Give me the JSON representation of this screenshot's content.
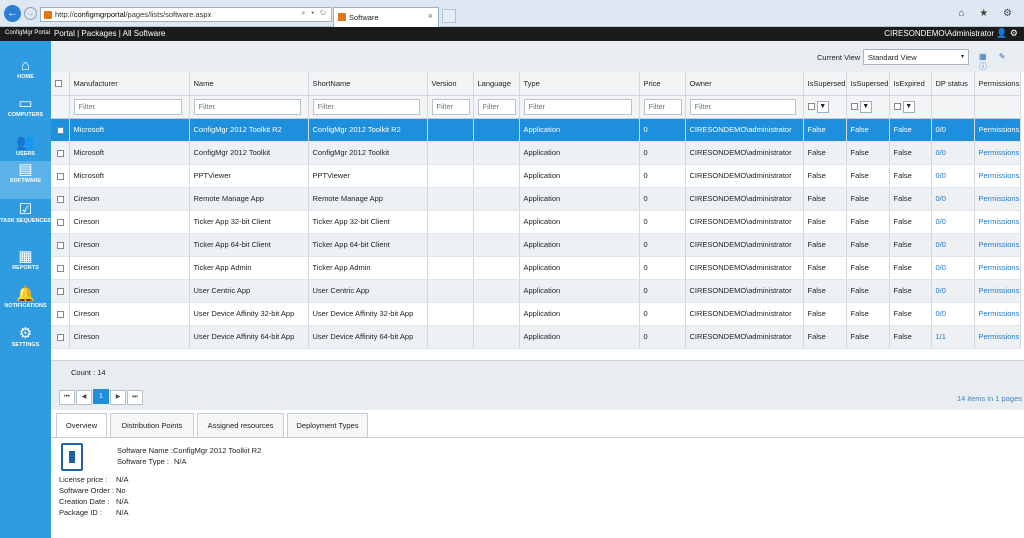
{
  "browser": {
    "url_prefix": "http://",
    "url_host": "configmgrportal",
    "url_path": "/pages/lists/software.aspx",
    "url_controls": "⌕ ▾ ↻",
    "tab_title": "Software",
    "tab_close": "×",
    "back_glyph": "←",
    "forward_glyph": "→",
    "window_icons": "⌂ ★ ⚙"
  },
  "app": {
    "logo": "ConfigMgr Portal",
    "breadcrumb": "Portal | Packages | All Software",
    "user": "CIRESONDEMO\\Administrator",
    "user_icons": "👤 ⚙"
  },
  "sidebar": {
    "items": [
      {
        "label": "HOME",
        "icon": "⌂"
      },
      {
        "label": "COMPUTERS",
        "icon": "▭"
      },
      {
        "label": "USERS",
        "icon": "👥"
      },
      {
        "label": "SOFTWARE",
        "icon": "▤"
      },
      {
        "label": "TASK SEQUENCES",
        "icon": "☑"
      },
      {
        "label": "REPORTS",
        "icon": "▦"
      },
      {
        "label": "NOTIFICATIONS",
        "icon": "🔔"
      },
      {
        "label": "SETTINGS",
        "icon": "⚙"
      }
    ],
    "active": "SOFTWARE"
  },
  "toolbar": {
    "current_view_label": "Current View :",
    "current_view_value": "Standard View",
    "dropdown_glyph": "▾",
    "icons": "▦ ✎ ⓘ"
  },
  "grid": {
    "columns": [
      "Manufacturer",
      "Name",
      "ShortName",
      "Version",
      "Language",
      "Type",
      "Price",
      "Owner",
      "IsSupersed",
      "IsSupersed",
      "IsExpired",
      "DP status",
      "Permissions"
    ],
    "filter_placeholder": "Filter",
    "filter_button": "▼",
    "rows": [
      {
        "manufacturer": "Microsoft",
        "name": "ConfigMgr 2012 Toolkit R2",
        "shortname": "ConfigMgr 2012 Toolkit R2",
        "version": "",
        "language": "",
        "type": "Application",
        "price": "0",
        "owner": "CIRESONDEMO\\administrator",
        "sup1": "False",
        "sup2": "False",
        "expired": "False",
        "dp": "0/0",
        "perm": "Permissions"
      },
      {
        "manufacturer": "Microsoft",
        "name": "ConfigMgr 2012 Toolkit",
        "shortname": "ConfigMgr 2012 Toolkit",
        "version": "",
        "language": "",
        "type": "Application",
        "price": "0",
        "owner": "CIRESONDEMO\\administrator",
        "sup1": "False",
        "sup2": "False",
        "expired": "False",
        "dp": "0/0",
        "perm": "Permissions"
      },
      {
        "manufacturer": "Microsoft",
        "name": "PPTViewer",
        "shortname": "PPTViewer",
        "version": "",
        "language": "",
        "type": "Application",
        "price": "0",
        "owner": "CIRESONDEMO\\administrator",
        "sup1": "False",
        "sup2": "False",
        "expired": "False",
        "dp": "0/0",
        "perm": "Permissions"
      },
      {
        "manufacturer": "Cireson",
        "name": "Remote Manage App",
        "shortname": "Remote Manage App",
        "version": "",
        "language": "",
        "type": "Application",
        "price": "0",
        "owner": "CIRESONDEMO\\administrator",
        "sup1": "False",
        "sup2": "False",
        "expired": "False",
        "dp": "0/0",
        "perm": "Permissions"
      },
      {
        "manufacturer": "Cireson",
        "name": "Ticker App 32-bit Client",
        "shortname": "Ticker App 32-bit Client",
        "version": "",
        "language": "",
        "type": "Application",
        "price": "0",
        "owner": "CIRESONDEMO\\administrator",
        "sup1": "False",
        "sup2": "False",
        "expired": "False",
        "dp": "0/0",
        "perm": "Permissions"
      },
      {
        "manufacturer": "Cireson",
        "name": "Ticker App 64-bit Client",
        "shortname": "Ticker App 64-bit Client",
        "version": "",
        "language": "",
        "type": "Application",
        "price": "0",
        "owner": "CIRESONDEMO\\administrator",
        "sup1": "False",
        "sup2": "False",
        "expired": "False",
        "dp": "0/0",
        "perm": "Permissions"
      },
      {
        "manufacturer": "Cireson",
        "name": "Ticker App Admin",
        "shortname": "Ticker App Admin",
        "version": "",
        "language": "",
        "type": "Application",
        "price": "0",
        "owner": "CIRESONDEMO\\administrator",
        "sup1": "False",
        "sup2": "False",
        "expired": "False",
        "dp": "0/0",
        "perm": "Permissions"
      },
      {
        "manufacturer": "Cireson",
        "name": "User Centric App",
        "shortname": "User Centric App",
        "version": "",
        "language": "",
        "type": "Application",
        "price": "0",
        "owner": "CIRESONDEMO\\administrator",
        "sup1": "False",
        "sup2": "False",
        "expired": "False",
        "dp": "0/0",
        "perm": "Permissions"
      },
      {
        "manufacturer": "Cireson",
        "name": "User Device Affinity 32-bit App",
        "shortname": "User Device Affinity 32-bit App",
        "version": "",
        "language": "",
        "type": "Application",
        "price": "0",
        "owner": "CIRESONDEMO\\administrator",
        "sup1": "False",
        "sup2": "False",
        "expired": "False",
        "dp": "0/0",
        "perm": "Permissions"
      },
      {
        "manufacturer": "Cireson",
        "name": "User Device Affinity 64-bit App",
        "shortname": "User Device Affinity 64-bit App",
        "version": "",
        "language": "",
        "type": "Application",
        "price": "0",
        "owner": "CIRESONDEMO\\administrator",
        "sup1": "False",
        "sup2": "False",
        "expired": "False",
        "dp": "1/1",
        "perm": "Permissions"
      }
    ]
  },
  "footer": {
    "count": "Count : 14",
    "pager": [
      "⏮",
      "◀",
      "1",
      "▶",
      "⏭"
    ],
    "items_info": "14 items in 1 pages"
  },
  "details": {
    "tabs": [
      "Overview",
      "Distribution Points",
      "Assigned resources",
      "Deployment Types"
    ],
    "software_name_label": "Software Name :",
    "software_name": "ConfigMgr 2012 Toolkit R2",
    "software_type_label": "Software Type :",
    "software_type": "N/A",
    "fields": [
      {
        "label": "License price :",
        "value": "N/A"
      },
      {
        "label": "Software Order :",
        "value": "No"
      },
      {
        "label": "Creation Date :",
        "value": "N/A"
      },
      {
        "label": "Package ID :",
        "value": "N/A"
      }
    ]
  }
}
